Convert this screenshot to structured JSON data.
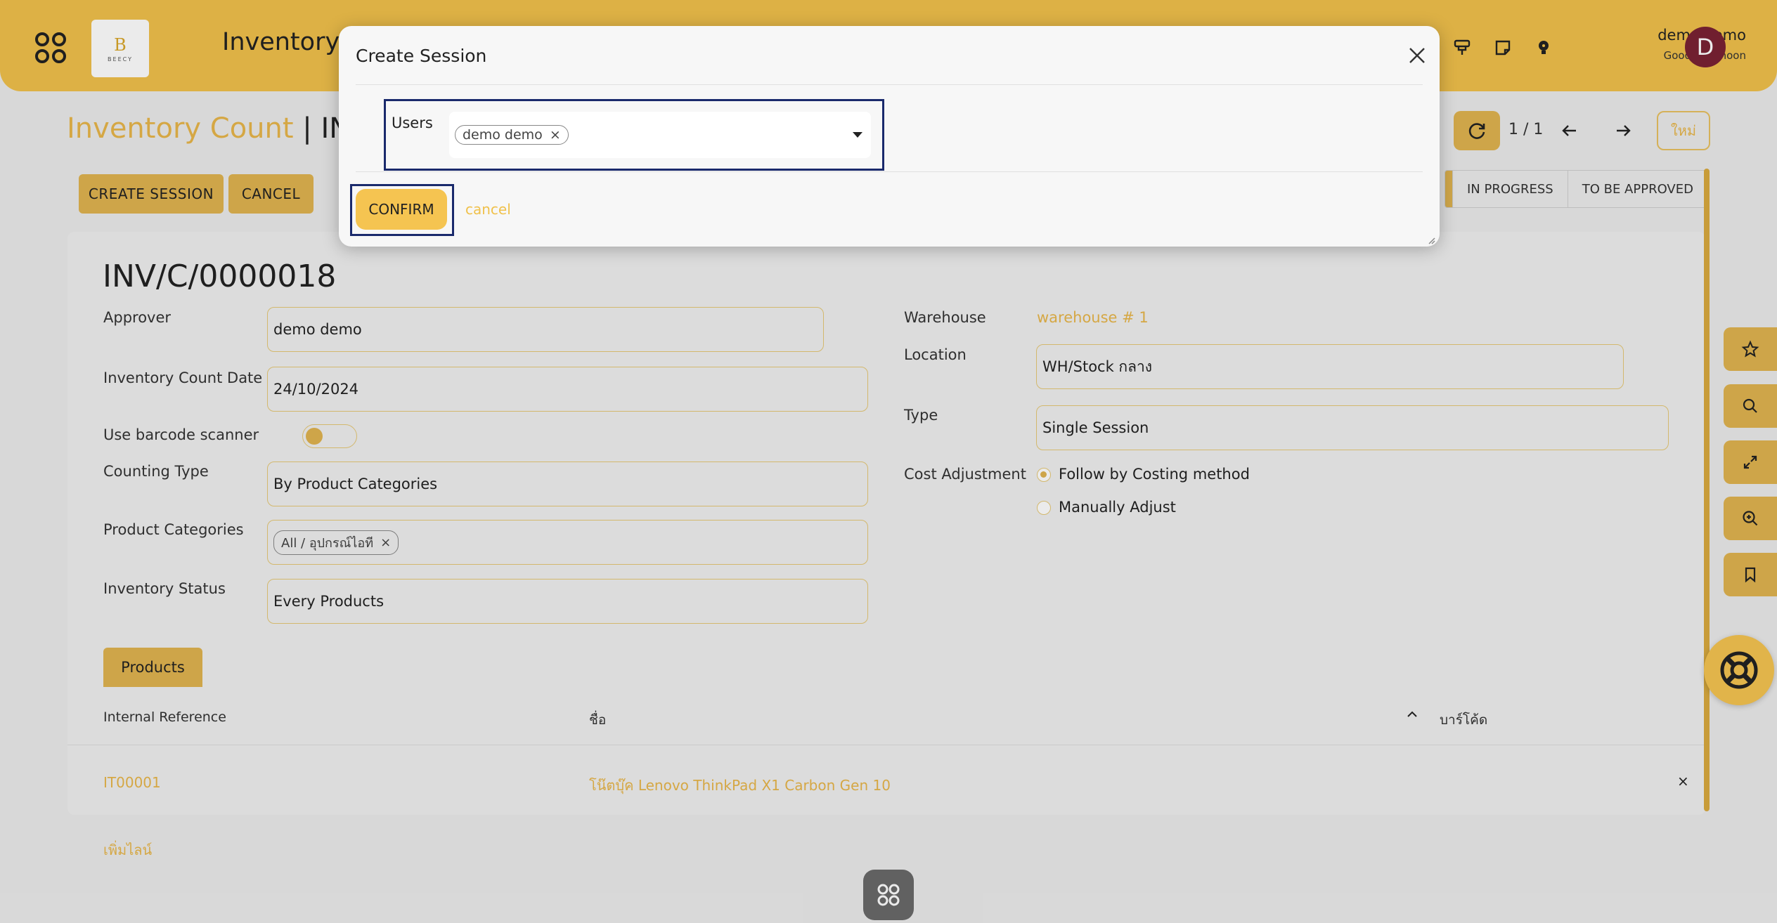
{
  "header": {
    "app_title": "Inventory",
    "logo_mark": "B",
    "logo_text": "BEECY",
    "user_name": "demo demo",
    "greeting": "Good Afternoon",
    "avatar_letter": "D"
  },
  "breadcrumb": {
    "parent": "Inventory Count",
    "separator": "|",
    "current": "INV/C"
  },
  "toolbar": {
    "create_session_label": "CREATE SESSION",
    "cancel_label": "CANCEL",
    "pager": "1 / 1",
    "new_label": "ใหม่"
  },
  "status_bar": {
    "stages": [
      "IN PROGRESS",
      "TO BE APPROVED"
    ]
  },
  "record": {
    "title": "INV/C/0000018",
    "left_fields": {
      "approver_label": "Approver",
      "approver_value": "demo demo",
      "date_label": "Inventory Count Date",
      "date_value": "24/10/2024",
      "barcode_label": "Use barcode scanner",
      "counting_type_label": "Counting Type",
      "counting_type_value": "By Product Categories",
      "product_categories_label": "Product Categories",
      "product_categories_tag": "All / อุปกรณ์ไอที",
      "inventory_status_label": "Inventory Status",
      "inventory_status_value": "Every Products"
    },
    "right_fields": {
      "warehouse_label": "Warehouse",
      "warehouse_value": "warehouse # 1",
      "location_label": "Location",
      "location_value": "WH/Stock กลาง",
      "type_label": "Type",
      "type_value": "Single Session",
      "cost_adjustment_label": "Cost Adjustment",
      "cost_options": [
        "Follow by Costing method",
        "Manually Adjust"
      ],
      "cost_selected": "Follow by Costing method"
    }
  },
  "products": {
    "tab_label": "Products",
    "columns": [
      "Internal Reference",
      "ชื่อ",
      "บาร์โค้ด"
    ],
    "rows": [
      {
        "ref": "IT00001",
        "name": "โน๊ตบุ๊ค Lenovo ThinkPad X1 Carbon Gen 10",
        "barcode": ""
      }
    ],
    "add_line": "เพิ่มไลน์"
  },
  "modal": {
    "title": "Create Session",
    "users_label": "Users",
    "selected_users": [
      "demo demo"
    ],
    "confirm_label": "CONFIRM",
    "cancel_label": "cancel"
  },
  "colors": {
    "brand": "#f0c14b",
    "accent": "#e0b450",
    "link": "#e8b64a",
    "highlight_border": "#1a2a6c",
    "avatar": "#7a2233"
  }
}
